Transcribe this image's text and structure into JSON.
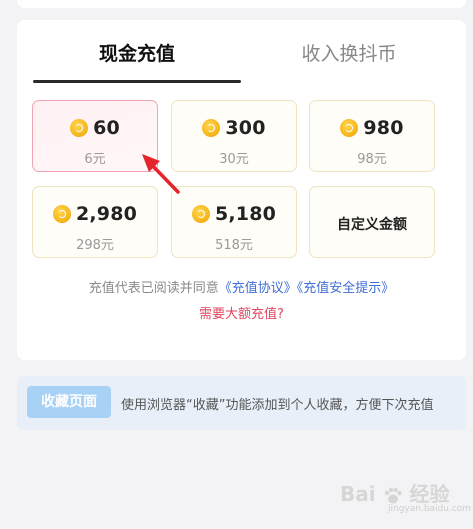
{
  "tabs": [
    {
      "label": "现金充值",
      "active": true
    },
    {
      "label": "收入换抖币",
      "active": false
    }
  ],
  "packages": [
    {
      "coins": "60",
      "price": "6元",
      "selected": true
    },
    {
      "coins": "300",
      "price": "30元",
      "selected": false
    },
    {
      "coins": "980",
      "price": "98元",
      "selected": false
    },
    {
      "coins": "2,980",
      "price": "298元",
      "selected": false
    },
    {
      "coins": "5,180",
      "price": "518元",
      "selected": false
    }
  ],
  "custom_amount_label": "自定义金额",
  "agreement": {
    "prefix": "充值代表已阅读并同意",
    "link1": "《充值协议》",
    "link2": "《充值安全提示》"
  },
  "large_recharge_link": "需要大额充值?",
  "bookmark": {
    "button_label": "收藏页面",
    "tip": "使用浏览器“收藏”功能添加到个人收藏，方便下次充值"
  },
  "watermark": {
    "text_a": "Bai",
    "text_b": "经验",
    "sub": "jingyan.baidu.com"
  },
  "colors": {
    "accent_red": "#e0465f",
    "link_blue": "#3f6ed8",
    "coin_gold": "#f5b51a",
    "selected_border": "#f2a5b1"
  },
  "icons": {
    "coin": "douyin-coin-icon",
    "arrow": "red-pointer-arrow"
  }
}
